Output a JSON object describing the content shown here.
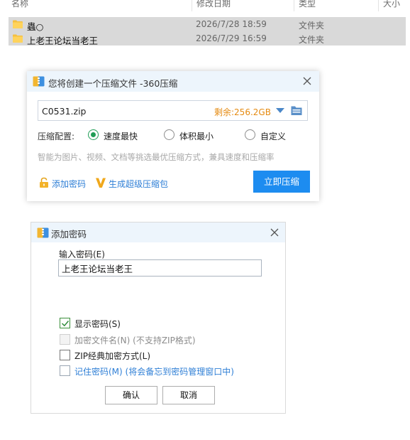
{
  "explorer": {
    "columns": [
      "名称",
      "修改日期",
      "类型",
      "大小"
    ],
    "files": [
      {
        "name": "蟲○",
        "date": "2026/7/28 18:59",
        "type": "文件夹"
      },
      {
        "name": "上老王论坛当老王",
        "date": "2026/7/29 16:59",
        "type": "文件夹"
      }
    ]
  },
  "compress_dialog": {
    "title": "您将创建一个压缩文件 -360压缩",
    "filename": "C0531.zip",
    "free_space": "剩余:256.2GB",
    "config_label": "压缩配置:",
    "options": [
      {
        "label": "速度最快",
        "selected": true
      },
      {
        "label": "体积最小",
        "selected": false
      },
      {
        "label": "自定义",
        "selected": false
      }
    ],
    "hint": "智能为图片、视频、文档等挑选最优压缩方式，兼具速度和压缩率",
    "add_password_link": "添加密码",
    "super_compress_link": "生成超级压缩包",
    "compress_button": "立即压缩"
  },
  "password_dialog": {
    "title": "添加密码",
    "input_label": "输入密码(E)",
    "password_value": "上老王论坛当老王",
    "checkboxes": [
      {
        "label": "显示密码(S)",
        "checked": true,
        "enabled": true
      },
      {
        "label": "加密文件名(N) (不支持ZIP格式)",
        "checked": false,
        "enabled": false
      },
      {
        "label": "ZIP经典加密方式(L)",
        "checked": false,
        "enabled": true
      },
      {
        "label": "记住密码(M) (将会备忘到密码管理窗口中)",
        "checked": false,
        "enabled": true
      }
    ],
    "ok_button": "确认",
    "cancel_button": "取消"
  },
  "colors": {
    "accent_blue": "#1d8cf0",
    "link_blue": "#2f7fd6",
    "free_space_orange": "#e58a10",
    "radio_green": "#1f9d55",
    "titlebar_bg": "#edf5fc",
    "row_selected": "#d9d9d9"
  }
}
